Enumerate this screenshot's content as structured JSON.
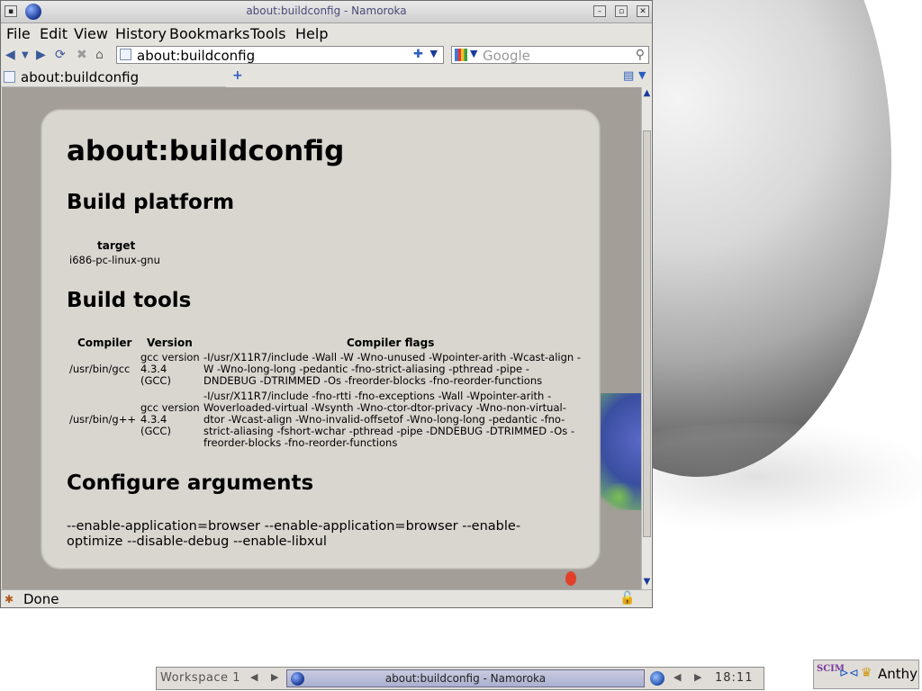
{
  "window": {
    "title": "about:buildconfig - Namoroka"
  },
  "menubar": {
    "items": [
      "File",
      "Edit",
      "View",
      "History",
      "Bookmarks",
      "Tools",
      "Help"
    ]
  },
  "navbar": {
    "url": "about:buildconfig",
    "search_placeholder": "Google"
  },
  "tabs": [
    {
      "label": "about:buildconfig",
      "active": true
    }
  ],
  "page": {
    "heading": "about:buildconfig",
    "build_platform": {
      "title": "Build platform",
      "header": "target",
      "value": "i686-pc-linux-gnu"
    },
    "build_tools": {
      "title": "Build tools",
      "headers": [
        "Compiler",
        "Version",
        "Compiler flags"
      ],
      "rows": [
        {
          "compiler": "/usr/bin/gcc",
          "version": "gcc version 4.3.4 (GCC)",
          "flags": "-I/usr/X11R7/include -Wall -W -Wno-unused -Wpointer-arith -Wcast-align -W -Wno-long-long -pedantic -fno-strict-aliasing -pthread -pipe -DNDEBUG -DTRIMMED -Os -freorder-blocks -fno-reorder-functions"
        },
        {
          "compiler": "/usr/bin/g++",
          "version": "gcc version 4.3.4 (GCC)",
          "flags": "-I/usr/X11R7/include -fno-rtti -fno-exceptions -Wall -Wpointer-arith -Woverloaded-virtual -Wsynth -Wno-ctor-dtor-privacy -Wno-non-virtual-dtor -Wcast-align -Wno-invalid-offsetof -Wno-long-long -pedantic -fno-strict-aliasing -fshort-wchar -pthread -pipe -DNDEBUG -DTRIMMED -Os -freorder-blocks -fno-reorder-functions"
        }
      ]
    },
    "configure": {
      "title": "Configure arguments",
      "args": "--enable-application=browser --enable-application=browser --enable-optimize --disable-debug --enable-libxul"
    }
  },
  "statusbar": {
    "text": "Done"
  },
  "taskbar": {
    "workspace": "Workspace 1",
    "task_title": "about:buildconfig - Namoroka",
    "clock": "18:11"
  },
  "tray": {
    "scim_logo": "SCIM",
    "ime_label": "Anthy"
  }
}
